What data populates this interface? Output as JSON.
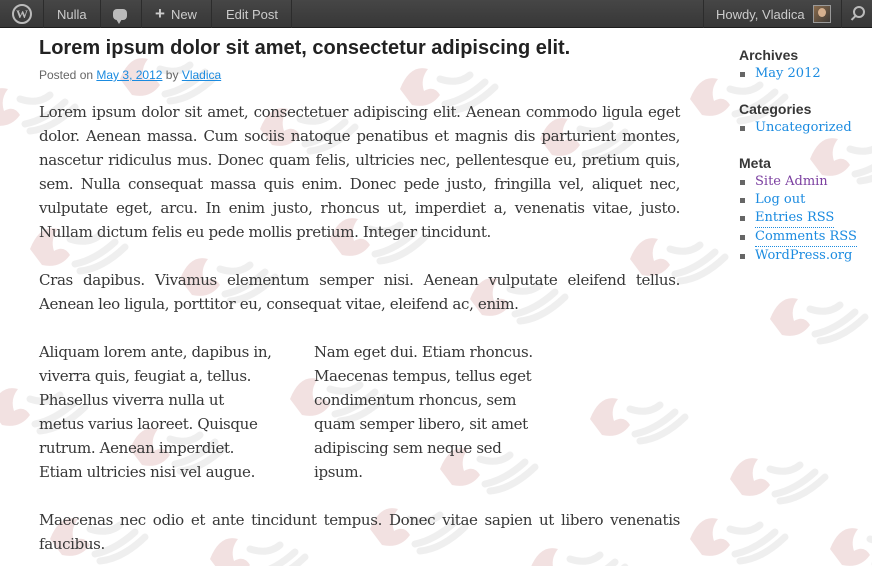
{
  "adminbar": {
    "site_name": "Nulla",
    "new_label": "New",
    "edit_label": "Edit Post",
    "howdy": "Howdy, Vladica",
    "wp_logo_icon": "wordpress-logo-icon",
    "comments_icon": "comment-bubble-icon",
    "plus_icon": "plus-icon",
    "search_icon": "search-icon",
    "bg_color": "#464646",
    "text_color": "#cccccc"
  },
  "post": {
    "title": "Lorem ipsum dolor sit amet, consectetur adipiscing elit.",
    "meta_posted_on": "Posted on",
    "meta_date": "May 3, 2012",
    "meta_by": "by",
    "meta_author": "Vladica",
    "paragraphs": [
      "Lorem ipsum dolor sit amet, consectetuer adipiscing elit. Aenean commodo ligula eget dolor. Aenean massa. Cum sociis natoque penatibus et magnis dis parturient montes, nascetur ridiculus mus. Donec quam felis, ultricies nec, pellentesque eu, pretium quis, sem. Nulla consequat massa quis enim. Donec pede justo, fringilla vel, aliquet nec, vulputate eget, arcu. In enim justo, rhoncus ut, imperdiet a, venenatis vitae, justo. Nullam dictum felis eu pede mollis pretium. Integer tincidunt.",
      "Cras dapibus. Vivamus elementum semper nisi. Aenean vulputate eleifend tellus. Aenean leo ligula, porttitor eu, consequat vitae, eleifend ac, enim.",
      "Maecenas nec odio et ante tincidunt tempus. Donec vitae sapien ut libero venenatis faucibus."
    ],
    "column_left": [
      "Aliquam lorem ante, dapibus in,",
      "viverra quis, feugiat a, tellus.",
      "Phasellus viverra nulla ut",
      "metus varius laoreet. Quisque",
      "rutrum. Aenean imperdiet.",
      "Etiam ultricies nisi vel augue."
    ],
    "column_right": [
      "Nam eget dui. Etiam rhoncus.",
      "Maecenas tempus, tellus eget",
      "condimentum rhoncus, sem",
      "quam semper libero, sit amet",
      "adipiscing sem neque sed",
      "ipsum."
    ],
    "link_color": "#1b8be0",
    "text_color": "#373737"
  },
  "sidebar": {
    "archives_title": "Archives",
    "archives": [
      "May 2012"
    ],
    "categories_title": "Categories",
    "categories": [
      "Uncategorized"
    ],
    "meta_title": "Meta",
    "meta_links": [
      "Site Admin",
      "Log out",
      "Entries RSS",
      "Comments RSS",
      "WordPress.org"
    ],
    "visited_color": "#7b3fa0"
  }
}
